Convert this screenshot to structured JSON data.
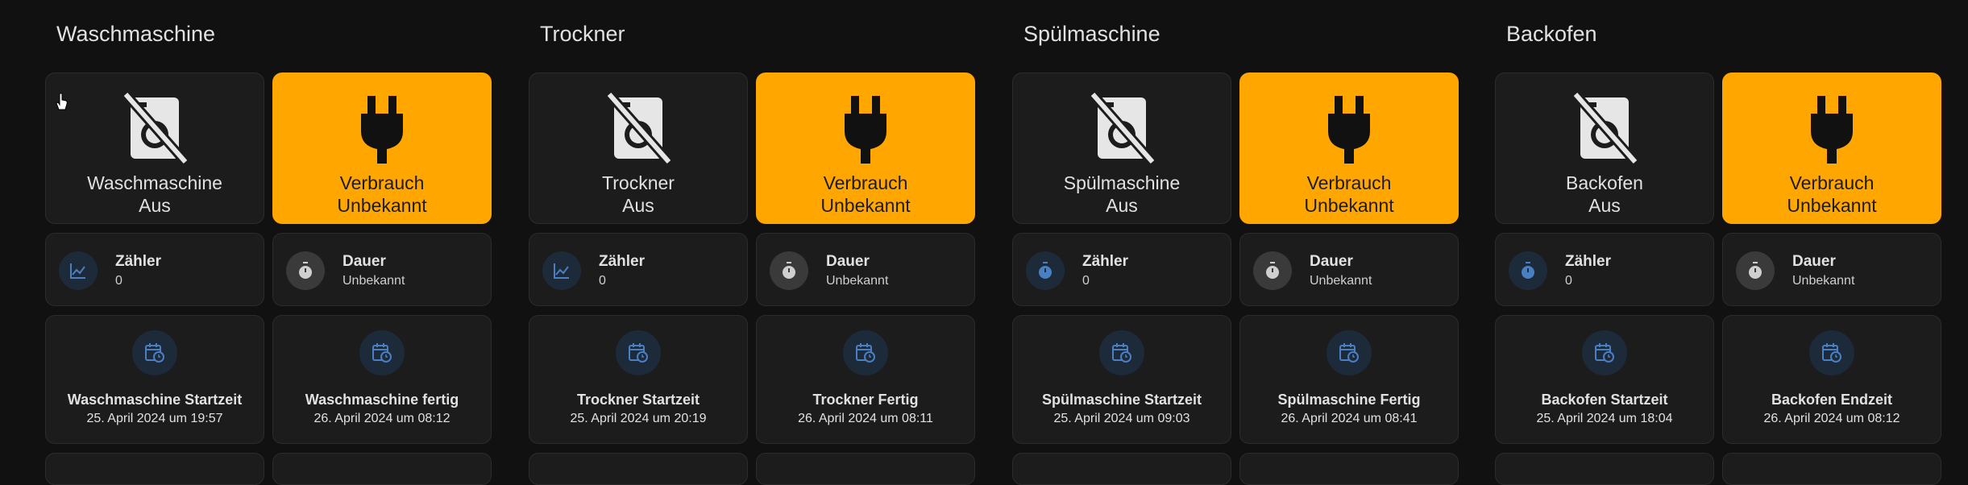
{
  "colors": {
    "background": "#111111",
    "card": "#1c1c1c",
    "accent": "#ffa600",
    "blue_icon": "#4a7fc1"
  },
  "columns": [
    {
      "title": "Waschmaschine",
      "device_icon": "washing-machine-off-icon",
      "device_name": "Waschmaschine",
      "device_state": "Aus",
      "power_name": "Verbrauch",
      "power_state": "Unbekannt",
      "counter_name": "Zähler",
      "counter_value": "0",
      "counter_icon": "chart-line-icon",
      "duration_name": "Dauer",
      "duration_value": "Unbekannt",
      "start_name": "Waschmaschine Startzeit",
      "start_value": "25. April 2024 um 19:57",
      "end_name": "Waschmaschine fertig",
      "end_value": "26. April 2024 um 08:12"
    },
    {
      "title": "Trockner",
      "device_icon": "tumble-dryer-off-icon",
      "device_name": "Trockner",
      "device_state": "Aus",
      "power_name": "Verbrauch",
      "power_state": "Unbekannt",
      "counter_name": "Zähler",
      "counter_value": "0",
      "counter_icon": "chart-line-icon",
      "duration_name": "Dauer",
      "duration_value": "Unbekannt",
      "start_name": "Trockner Startzeit",
      "start_value": "25. April 2024 um 20:19",
      "end_name": "Trockner Fertig",
      "end_value": "26. April 2024 um 08:11"
    },
    {
      "title": "Spülmaschine",
      "device_icon": "dishwasher-off-icon",
      "device_name": "Spülmaschine",
      "device_state": "Aus",
      "power_name": "Verbrauch",
      "power_state": "Unbekannt",
      "counter_name": "Zähler",
      "counter_value": "0",
      "counter_icon": "timer-icon",
      "duration_name": "Dauer",
      "duration_value": "Unbekannt",
      "start_name": "Spülmaschine Startzeit",
      "start_value": "25. April 2024 um 09:03",
      "end_name": "Spülmaschine Fertig",
      "end_value": "26. April 2024 um 08:41"
    },
    {
      "title": "Backofen",
      "device_icon": "stove-off-icon",
      "device_name": "Backofen",
      "device_state": "Aus",
      "power_name": "Verbrauch",
      "power_state": "Unbekannt",
      "counter_name": "Zähler",
      "counter_value": "0",
      "counter_icon": "timer-icon",
      "duration_name": "Dauer",
      "duration_value": "Unbekannt",
      "start_name": "Backofen Startzeit",
      "start_value": "25. April 2024 um 18:04",
      "end_name": "Backofen Endzeit",
      "end_value": "26. April 2024 um 08:12"
    }
  ]
}
